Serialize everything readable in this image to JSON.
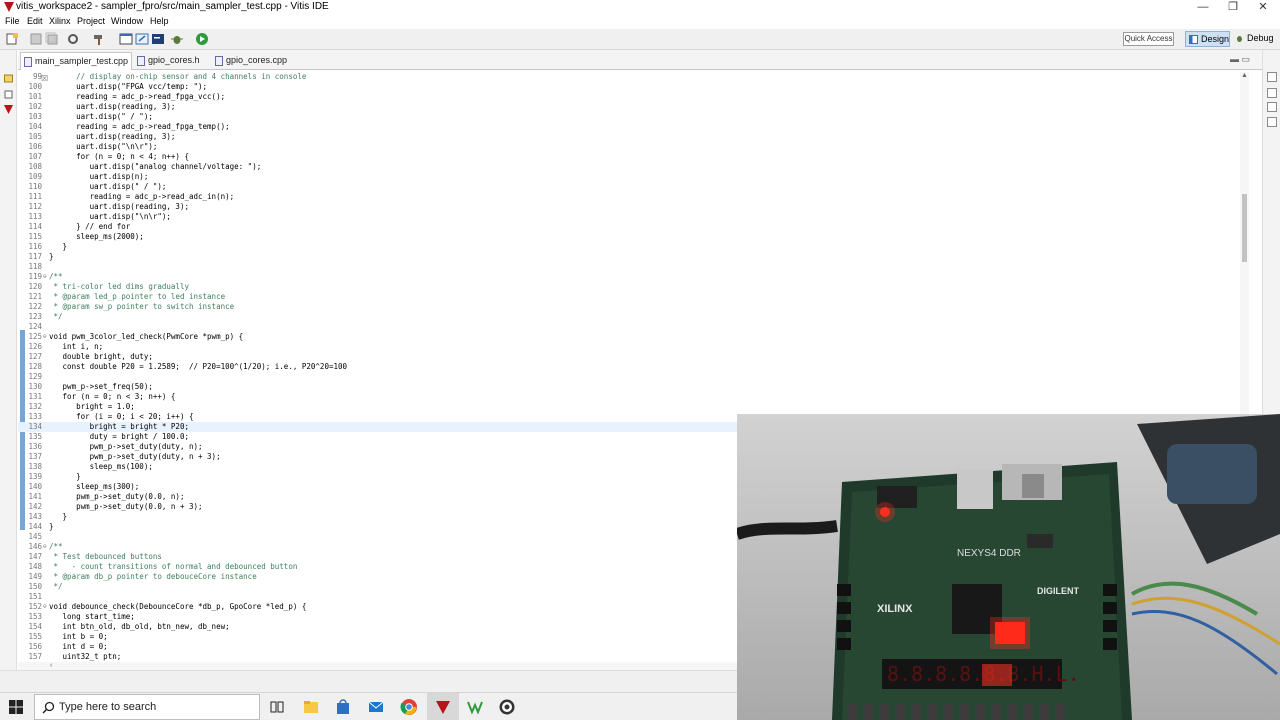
{
  "window": {
    "title": "vitis_workspace2 - sampler_fpro/src/main_sampler_test.cpp - Vitis IDE",
    "minimize": "—",
    "restore": "❐",
    "close": "✕"
  },
  "menu": {
    "items": [
      "File",
      "Edit",
      "Xilinx",
      "Project",
      "Window",
      "Help"
    ]
  },
  "toolbar": {
    "quick_access": "Quick Access",
    "design": "Design",
    "debug": "Debug"
  },
  "tabs": [
    {
      "label": "main_sampler_test.cpp",
      "close": "☒",
      "active": true
    },
    {
      "label": "gpio_cores.h",
      "close": "",
      "active": false
    },
    {
      "label": "gpio_cores.cpp",
      "close": "",
      "active": false
    }
  ],
  "tab_controls": "▬  ▭",
  "editor": {
    "lines": [
      {
        "n": "99",
        "fold": "",
        "code": "      // display on-chip sensor and 4 channels in console"
      },
      {
        "n": "100",
        "fold": "",
        "code": "      uart.disp(\"FPGA vcc/temp: \");"
      },
      {
        "n": "101",
        "fold": "",
        "code": "      reading = adc_p->read_fpga_vcc();"
      },
      {
        "n": "102",
        "fold": "",
        "code": "      uart.disp(reading, 3);"
      },
      {
        "n": "103",
        "fold": "",
        "code": "      uart.disp(\" / \");"
      },
      {
        "n": "104",
        "fold": "",
        "code": "      reading = adc_p->read_fpga_temp();"
      },
      {
        "n": "105",
        "fold": "",
        "code": "      uart.disp(reading, 3);"
      },
      {
        "n": "106",
        "fold": "",
        "code": "      uart.disp(\"\\n\\r\");"
      },
      {
        "n": "107",
        "fold": "",
        "code": "      for (n = 0; n < 4; n++) {"
      },
      {
        "n": "108",
        "fold": "",
        "code": "         uart.disp(\"analog channel/voltage: \");"
      },
      {
        "n": "109",
        "fold": "",
        "code": "         uart.disp(n);"
      },
      {
        "n": "110",
        "fold": "",
        "code": "         uart.disp(\" / \");"
      },
      {
        "n": "111",
        "fold": "",
        "code": "         reading = adc_p->read_adc_in(n);"
      },
      {
        "n": "112",
        "fold": "",
        "code": "         uart.disp(reading, 3);"
      },
      {
        "n": "113",
        "fold": "",
        "code": "         uart.disp(\"\\n\\r\");"
      },
      {
        "n": "114",
        "fold": "",
        "code": "      } // end for"
      },
      {
        "n": "115",
        "fold": "",
        "code": "      sleep_ms(2000);"
      },
      {
        "n": "116",
        "fold": "",
        "code": "   }"
      },
      {
        "n": "117",
        "fold": "",
        "code": "}"
      },
      {
        "n": "118",
        "fold": "",
        "code": ""
      },
      {
        "n": "119",
        "fold": "⊖",
        "code": "/**"
      },
      {
        "n": "120",
        "fold": "",
        "code": " * tri-color led dims gradually"
      },
      {
        "n": "121",
        "fold": "",
        "code": " * @param led_p pointer to led instance"
      },
      {
        "n": "122",
        "fold": "",
        "code": " * @param sw_p pointer to switch instance"
      },
      {
        "n": "123",
        "fold": "",
        "code": " */"
      },
      {
        "n": "124",
        "fold": "",
        "code": ""
      },
      {
        "n": "125",
        "fold": "⊖",
        "code": "void pwm_3color_led_check(PwmCore *pwm_p) {"
      },
      {
        "n": "126",
        "fold": "",
        "code": "   int i, n;"
      },
      {
        "n": "127",
        "fold": "",
        "code": "   double bright, duty;"
      },
      {
        "n": "128",
        "fold": "",
        "code": "   const double P20 = 1.2589;  // P20=100^(1/20); i.e., P20^20=100"
      },
      {
        "n": "129",
        "fold": "",
        "code": ""
      },
      {
        "n": "130",
        "fold": "",
        "code": "   pwm_p->set_freq(50);"
      },
      {
        "n": "131",
        "fold": "",
        "code": "   for (n = 0; n < 3; n++) {"
      },
      {
        "n": "132",
        "fold": "",
        "code": "      bright = 1.0;"
      },
      {
        "n": "133",
        "fold": "",
        "code": "      for (i = 0; i < 20; i++) {"
      },
      {
        "n": "134",
        "fold": "",
        "code": "         bright = bright * P20;"
      },
      {
        "n": "135",
        "fold": "",
        "code": "         duty = bright / 100.0;"
      },
      {
        "n": "136",
        "fold": "",
        "code": "         pwm_p->set_duty(duty, n);"
      },
      {
        "n": "137",
        "fold": "",
        "code": "         pwm_p->set_duty(duty, n + 3);"
      },
      {
        "n": "138",
        "fold": "",
        "code": "         sleep_ms(100);"
      },
      {
        "n": "139",
        "fold": "",
        "code": "      }"
      },
      {
        "n": "140",
        "fold": "",
        "code": "      sleep_ms(300);"
      },
      {
        "n": "141",
        "fold": "",
        "code": "      pwm_p->set_duty(0.0, n);"
      },
      {
        "n": "142",
        "fold": "",
        "code": "      pwm_p->set_duty(0.0, n + 3);"
      },
      {
        "n": "143",
        "fold": "",
        "code": "   }"
      },
      {
        "n": "144",
        "fold": "",
        "code": "}"
      },
      {
        "n": "145",
        "fold": "",
        "code": ""
      },
      {
        "n": "146",
        "fold": "⊖",
        "code": "/**"
      },
      {
        "n": "147",
        "fold": "",
        "code": " * Test debounced buttons"
      },
      {
        "n": "148",
        "fold": "",
        "code": " *   - count transitions of normal and debounced button"
      },
      {
        "n": "149",
        "fold": "",
        "code": " * @param db_p pointer to debouceCore instance"
      },
      {
        "n": "150",
        "fold": "",
        "code": " */"
      },
      {
        "n": "151",
        "fold": "",
        "code": ""
      },
      {
        "n": "152",
        "fold": "⊖",
        "code": "void debounce_check(DebounceCore *db_p, GpoCore *led_p) {"
      },
      {
        "n": "153",
        "fold": "",
        "code": "   long start_time;"
      },
      {
        "n": "154",
        "fold": "",
        "code": "   int btn_old, db_old, btn_new, db_new;"
      },
      {
        "n": "155",
        "fold": "",
        "code": "   int b = 0;"
      },
      {
        "n": "156",
        "fold": "",
        "code": "   int d = 0;"
      },
      {
        "n": "157",
        "fold": "",
        "code": "   uint32_t ptn;"
      }
    ]
  },
  "hscroll_arrow": "‹",
  "vscroll": {
    "up": "▲",
    "down": "▼"
  },
  "taskbar": {
    "search_placeholder": "Type here to search"
  },
  "video": {
    "board_label": "NEXYS4 DDR",
    "xilinx_label": "XILINX",
    "digilent_label": "DIGILENT",
    "display_text": "8.8.8.8.8.8.H.L."
  },
  "colors": {
    "accent": "#3b78c2",
    "change_bar": "#74a6d6",
    "vitis_red": "#b4151b"
  }
}
